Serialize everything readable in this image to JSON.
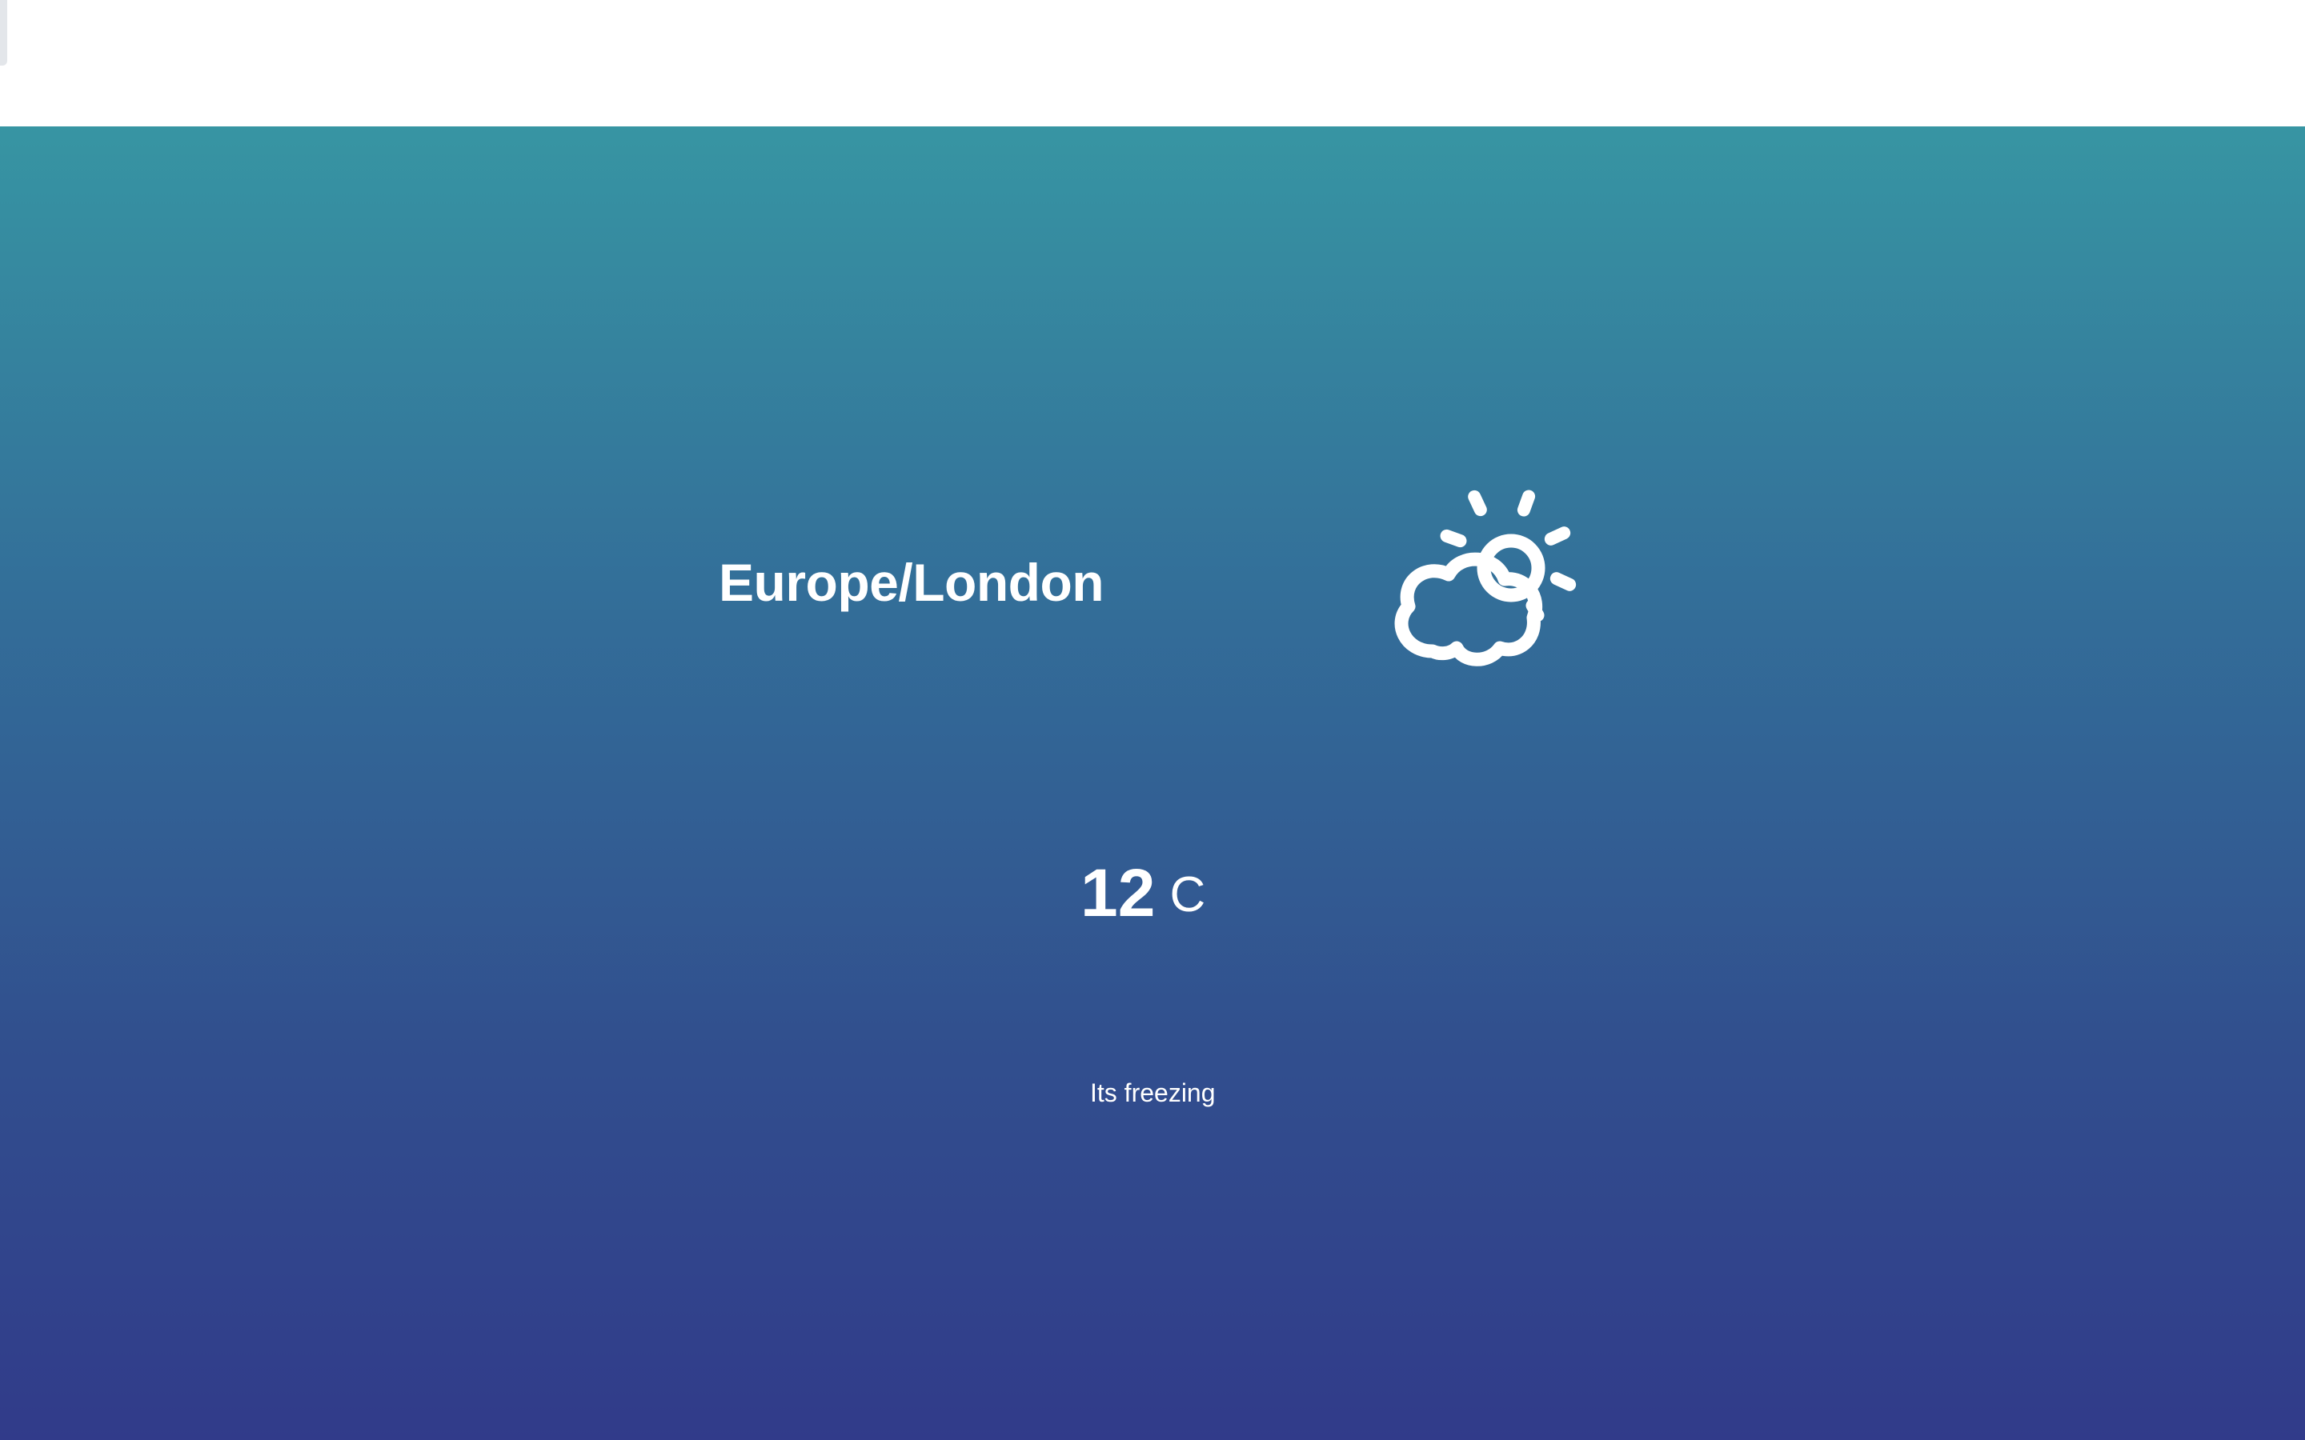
{
  "weather": {
    "timezone": "Europe/London",
    "temperature": "12",
    "unit": "C",
    "summary": "Its freezing",
    "icon": "partly-cloudy-day-icon"
  },
  "colors": {
    "gradient_top": "#3795a3",
    "gradient_bottom": "#313b8a",
    "text": "#ffffff"
  }
}
